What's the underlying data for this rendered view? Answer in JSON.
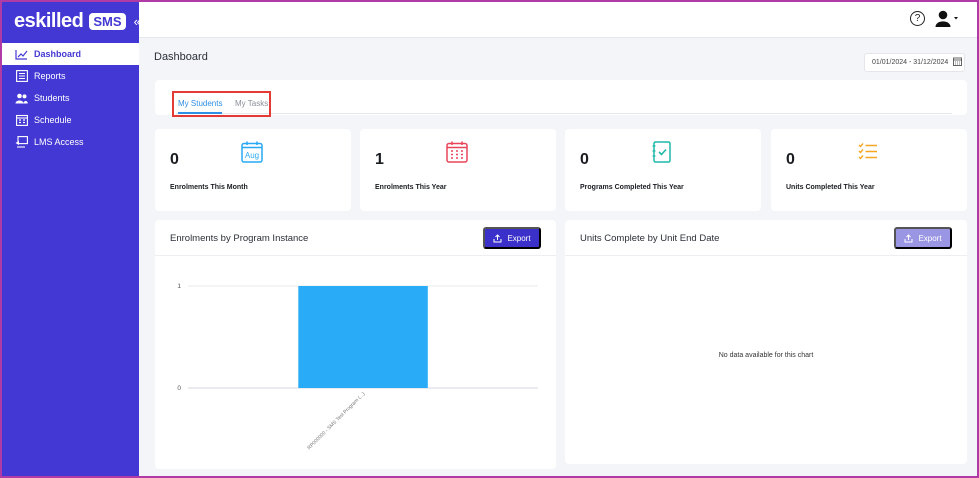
{
  "brand": {
    "name": "eskilled",
    "badge": "SMS",
    "collapse_glyph": "«"
  },
  "sidebar": {
    "items": [
      {
        "label": "Dashboard",
        "icon": "line-chart-icon",
        "active": true
      },
      {
        "label": "Reports",
        "icon": "reports-icon",
        "active": false
      },
      {
        "label": "Students",
        "icon": "students-icon",
        "active": false
      },
      {
        "label": "Schedule",
        "icon": "schedule-icon",
        "active": false
      },
      {
        "label": "LMS Access",
        "icon": "lms-access-icon",
        "active": false
      }
    ]
  },
  "topbar": {
    "help_glyph": "?"
  },
  "page": {
    "title": "Dashboard",
    "date_range": "01/01/2024 - 31/12/2024"
  },
  "tabs": [
    {
      "label": "My Students",
      "active": true
    },
    {
      "label": "My Tasks",
      "active": false
    }
  ],
  "stats": [
    {
      "value": "0",
      "label": "Enrolments This Month",
      "icon": "calendar-aug-icon",
      "icon_text": "Aug",
      "color": "#29a8f5"
    },
    {
      "value": "1",
      "label": "Enrolments This Year",
      "icon": "calendar-grid-icon",
      "color": "#e8455a"
    },
    {
      "value": "0",
      "label": "Programs Completed This Year",
      "icon": "checklist-notebook-icon",
      "color": "#1fb8a8"
    },
    {
      "value": "0",
      "label": "Units Completed This Year",
      "icon": "task-list-icon",
      "color": "#f5a623"
    }
  ],
  "cards": {
    "enrolments": {
      "title": "Enrolments by Program Instance",
      "export_label": "Export"
    },
    "units": {
      "title": "Units Complete by Unit End Date",
      "export_label": "Export",
      "no_data": "No data available for this chart"
    }
  },
  "chart_data": {
    "type": "bar",
    "categories": [
      "RP000000 - SMS Test Program (...)"
    ],
    "values": [
      1
    ],
    "ylim": [
      0,
      1
    ],
    "yticks": [
      "0",
      "1"
    ],
    "color": "#29abf8"
  }
}
